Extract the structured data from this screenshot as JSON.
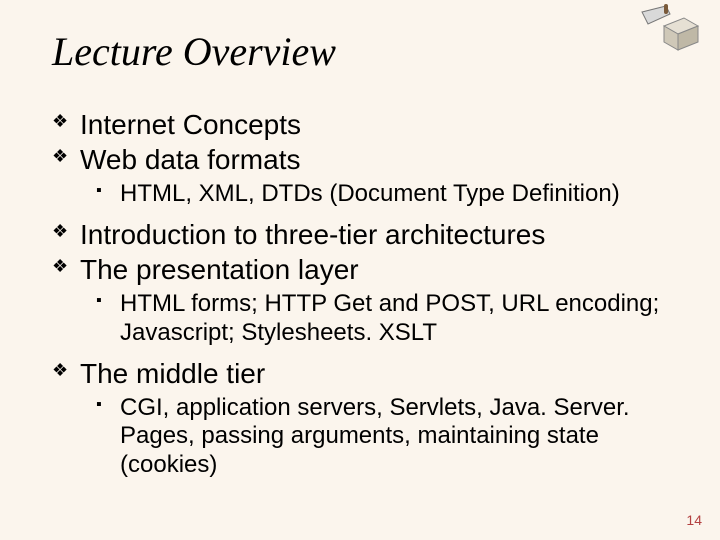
{
  "title": "Lecture Overview",
  "items": [
    {
      "level": 1,
      "text": "Internet Concepts"
    },
    {
      "level": 1,
      "text": "Web data formats"
    },
    {
      "level": 2,
      "text": "HTML, XML, DTDs (Document Type Definition)"
    },
    {
      "level": 1,
      "text": "Introduction to three-tier architectures"
    },
    {
      "level": 1,
      "text": "The presentation layer"
    },
    {
      "level": 2,
      "text": "HTML forms; HTTP Get and POST, URL encoding; Javascript; Stylesheets. XSLT"
    },
    {
      "level": 1,
      "text": "The middle tier"
    },
    {
      "level": 2,
      "text": "CGI, application servers, Servlets, Java. Server. Pages, passing arguments, maintaining state (cookies)"
    }
  ],
  "page_number": "14"
}
